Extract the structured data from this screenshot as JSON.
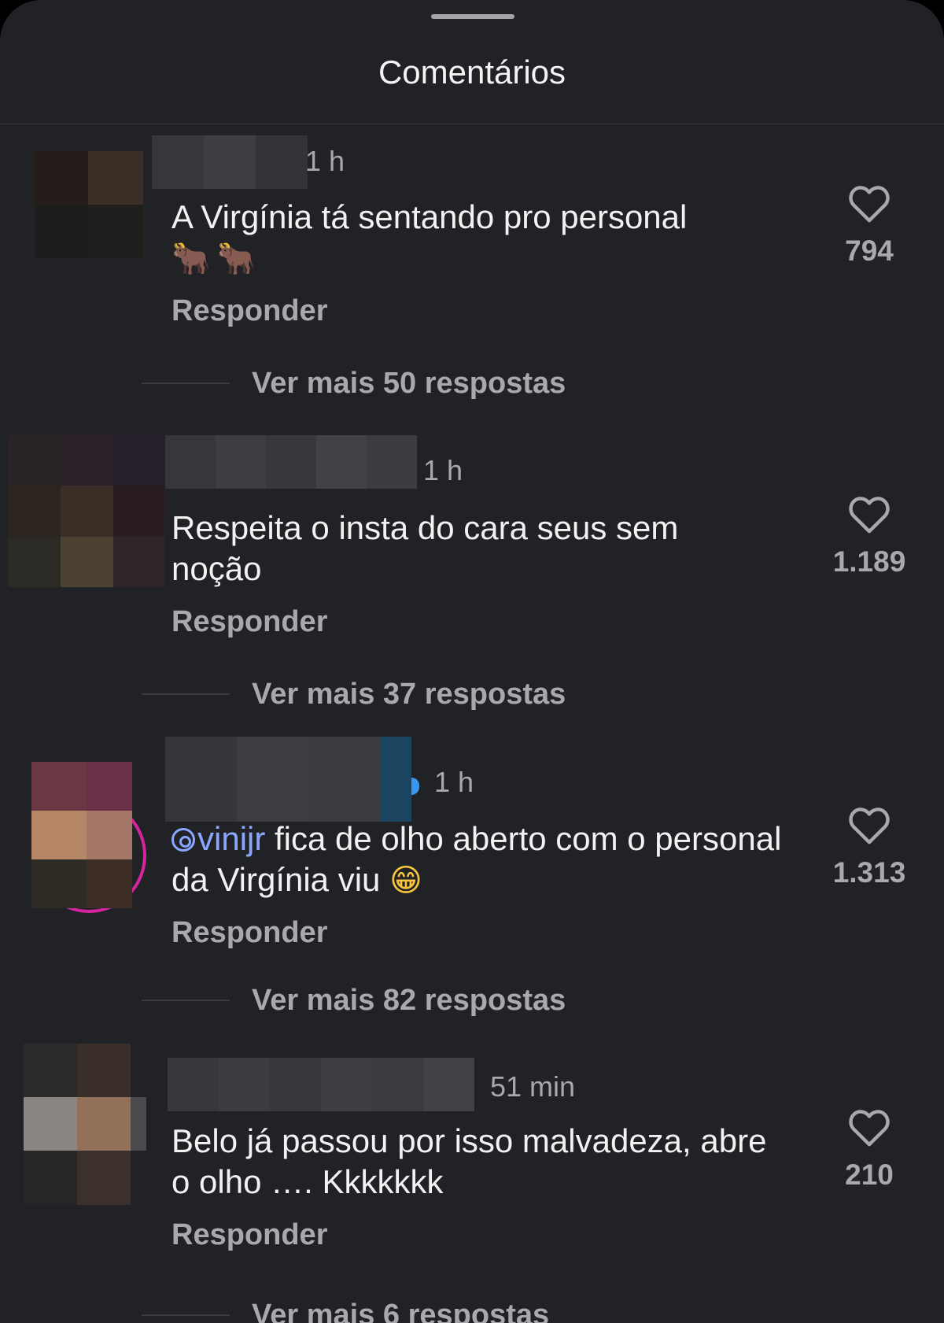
{
  "sheet": {
    "title": "Comentários"
  },
  "comments": [
    {
      "time": "1 h",
      "text": "A Virgínia tá sentando pro personal",
      "emoji": "🐂🐂",
      "reply_label": "Responder",
      "likes": "794",
      "more_replies": "Ver mais 50 respostas"
    },
    {
      "time": "1 h",
      "text": "Respeita o insta do cara seus sem noção",
      "reply_label": "Responder",
      "likes": "1.189",
      "more_replies": "Ver mais 37 respostas"
    },
    {
      "time": "1 h",
      "mention": "vinijr",
      "text": " fica de olho aberto com o personal da Virgínia viu ",
      "emoji": "😁",
      "reply_label": "Responder",
      "likes": "1.313",
      "more_replies": "Ver mais 82 respostas"
    },
    {
      "time": "51 min",
      "text": "Belo já passou por isso malvadeza, abre o olho …. Kkkkkkk",
      "reply_label": "Responder",
      "likes": "210",
      "more_replies": "Ver mais 6 respostas"
    }
  ]
}
